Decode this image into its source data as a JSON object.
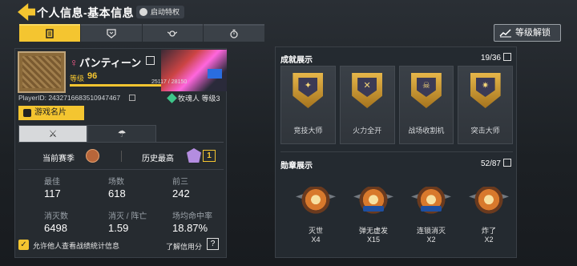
{
  "header": {
    "title": "个人信息-基本信息",
    "privilege_label": "启动特权"
  },
  "tabs": [
    {
      "name": "profile",
      "icon": "document-icon",
      "active": true
    },
    {
      "name": "career",
      "icon": "shield-icon",
      "active": false
    },
    {
      "name": "honor",
      "icon": "wings-badge-icon",
      "active": false
    },
    {
      "name": "timer",
      "icon": "stopwatch-icon",
      "active": false
    }
  ],
  "unlock_button": {
    "label": "等级解锁",
    "icon": "chart-up-icon"
  },
  "profile": {
    "name": "パンティーン",
    "gender_symbol": "♀",
    "level_label": "等级",
    "level": "96",
    "xp_text": "25117 / 28150",
    "xp_fraction": 0.89,
    "player_id": "PlayerID: 2432716683510947467",
    "soul_level": "牧魂人 等级3",
    "name_card_label": "游戏名片"
  },
  "season": {
    "current_label": "当前赛季",
    "history_label": "历史最高",
    "history_value": "1"
  },
  "stats": [
    {
      "label": "最佳",
      "value": "117"
    },
    {
      "label": "场数",
      "value": "618"
    },
    {
      "label": "前三",
      "value": "242"
    },
    {
      "label": "消灭数",
      "value": "6498"
    },
    {
      "label": "消灭 / 阵亡",
      "value": "1.59"
    },
    {
      "label": "场均命中率",
      "value": "18.87%"
    }
  ],
  "footer": {
    "allow_label": "允许他人查看战绩统计信息",
    "credit_label": "了解信用分",
    "help_symbol": "?"
  },
  "achievements": {
    "title": "成就展示",
    "count": "19/36",
    "items": [
      {
        "label": "竞技大师",
        "symbol": "✦"
      },
      {
        "label": "火力全开",
        "symbol": "✕"
      },
      {
        "label": "战场收割机",
        "symbol": "☠"
      },
      {
        "label": "突击大师",
        "symbol": "✷"
      }
    ]
  },
  "medals": {
    "title": "勋章展示",
    "count": "52/87",
    "items": [
      {
        "label": "灭世",
        "count": "X4"
      },
      {
        "label": "弹无虚发",
        "count": "X15"
      },
      {
        "label": "连锁消灭",
        "count": "X2"
      },
      {
        "label": "炸了",
        "count": "X2"
      }
    ]
  },
  "colors": {
    "accent": "#f4c530",
    "background": "#1e2226",
    "panel": "#262b30"
  }
}
